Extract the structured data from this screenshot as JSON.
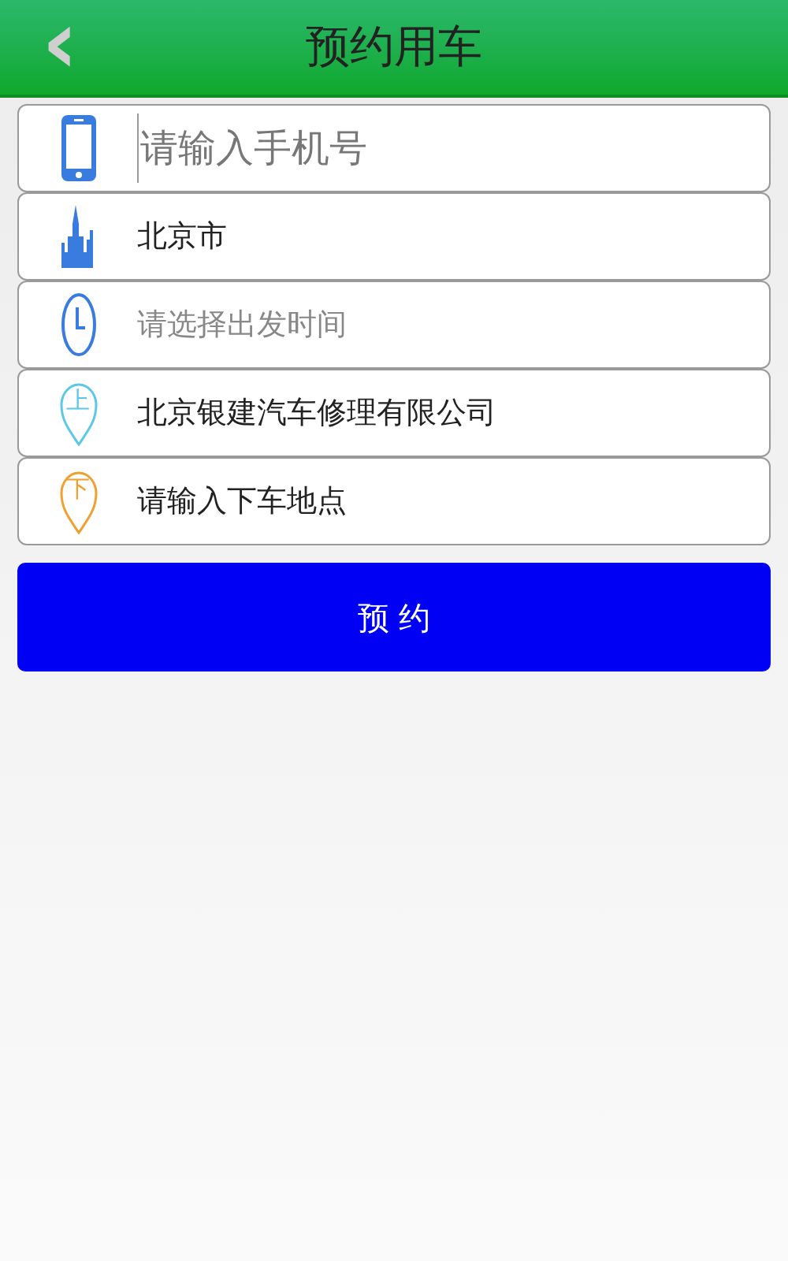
{
  "header": {
    "back": "‹",
    "title": "预约用车"
  },
  "rows": [
    {
      "kind": "phone",
      "placeholder": "请输入手机号"
    },
    {
      "kind": "city",
      "text": "北京市",
      "muted": false
    },
    {
      "kind": "time",
      "text": "请选择出发时间",
      "muted": true
    },
    {
      "kind": "pin",
      "pin_label": "上",
      "color": "#5bc8e8",
      "text": "北京银建汽车修理有限公司",
      "muted": false
    },
    {
      "kind": "pin",
      "pin_label": "下",
      "color": "#f0a030",
      "text": "请输入下车地点",
      "muted": false
    }
  ],
  "button": "预 约"
}
